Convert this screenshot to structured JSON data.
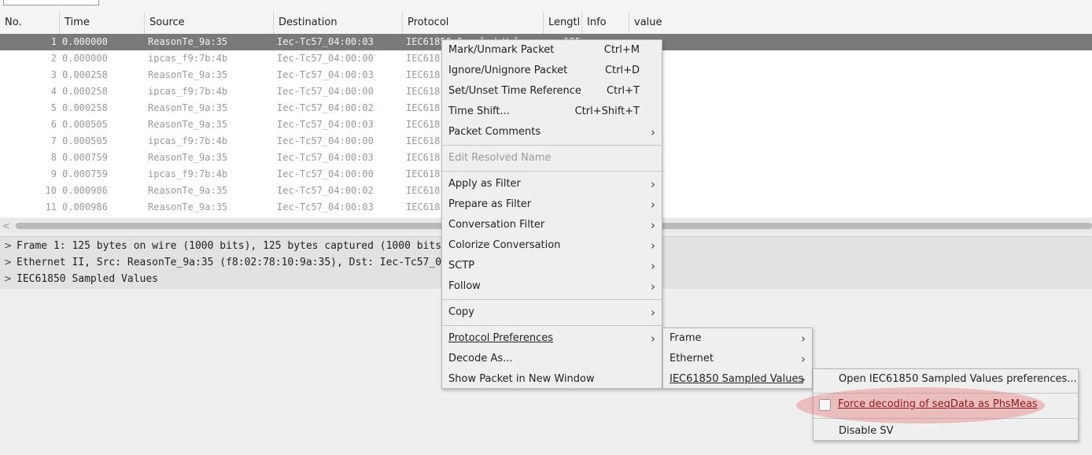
{
  "columns": [
    "No.",
    "Time",
    "Source",
    "Destination",
    "Protocol",
    "Lengtl",
    "Info",
    "value"
  ],
  "packets": [
    {
      "no": "1",
      "time": "0.000000",
      "source": "ReasonTe_9a:35",
      "destination": "Iec-Tc57_04:00:03",
      "protocol": "IEC61850 Sampled Valu",
      "length": "125",
      "selected": true
    },
    {
      "no": "2",
      "time": "0.000000",
      "source": "ipcas_f9:7b:4b",
      "destination": "Iec-Tc57_04:00:00",
      "protocol": "IEC618"
    },
    {
      "no": "3",
      "time": "0.000258",
      "source": "ReasonTe_9a:35",
      "destination": "Iec-Tc57_04:00:03",
      "protocol": "IEC618"
    },
    {
      "no": "4",
      "time": "0.000258",
      "source": "ipcas_f9:7b:4b",
      "destination": "Iec-Tc57_04:00:00",
      "protocol": "IEC618"
    },
    {
      "no": "5",
      "time": "0.000258",
      "source": "ReasonTe_9a:35",
      "destination": "Iec-Tc57_04:00:02",
      "protocol": "IEC618"
    },
    {
      "no": "6",
      "time": "0.000505",
      "source": "ReasonTe_9a:35",
      "destination": "Iec-Tc57_04:00:03",
      "protocol": "IEC618"
    },
    {
      "no": "7",
      "time": "0.000505",
      "source": "ipcas_f9:7b:4b",
      "destination": "Iec-Tc57_04:00:00",
      "protocol": "IEC618"
    },
    {
      "no": "8",
      "time": "0.000759",
      "source": "ReasonTe_9a:35",
      "destination": "Iec-Tc57_04:00:03",
      "protocol": "IEC618"
    },
    {
      "no": "9",
      "time": "0.000759",
      "source": "ipcas_f9:7b:4b",
      "destination": "Iec-Tc57_04:00:00",
      "protocol": "IEC618"
    },
    {
      "no": "10",
      "time": "0.000986",
      "source": "ReasonTe_9a:35",
      "destination": "Iec-Tc57_04:00:02",
      "protocol": "IEC618"
    },
    {
      "no": "11",
      "time": "0.000986",
      "source": "ReasonTe_9a:35",
      "destination": "Iec-Tc57_04:00:03",
      "protocol": "IEC618"
    }
  ],
  "details": [
    "Frame 1: 125 bytes on wire (1000 bits), 125 bytes captured (1000 bits",
    "Ethernet II, Src: ReasonTe_9a:35 (f8:02:78:10:9a:35), Dst: Iec-Tc57_04",
    "IEC61850 Sampled Values"
  ],
  "context_menu": {
    "mark": {
      "label": "Mark/Unmark Packet",
      "shortcut": "Ctrl+M"
    },
    "ignore": {
      "label": "Ignore/Unignore Packet",
      "shortcut": "Ctrl+D"
    },
    "time_ref": {
      "label": "Set/Unset Time Reference",
      "shortcut": "Ctrl+T"
    },
    "time_shift": {
      "label": "Time Shift...",
      "shortcut": "Ctrl+Shift+T"
    },
    "comments": {
      "label": "Packet Comments"
    },
    "edit_resolved": {
      "label": "Edit Resolved Name"
    },
    "apply_filter": {
      "label": "Apply as Filter"
    },
    "prepare_filter": {
      "label": "Prepare as Filter"
    },
    "conversation_filter": {
      "label": "Conversation Filter"
    },
    "colorize": {
      "label": "Colorize Conversation"
    },
    "sctp": {
      "label": "SCTP"
    },
    "follow": {
      "label": "Follow"
    },
    "copy": {
      "label": "Copy"
    },
    "protocol_prefs": {
      "label": "Protocol Preferences"
    },
    "decode_as": {
      "label": "Decode As..."
    },
    "new_window": {
      "label": "Show Packet in New Window"
    }
  },
  "prefs_submenu": {
    "frame": "Frame",
    "ethernet": "Ethernet",
    "sv": "IEC61850 Sampled Values"
  },
  "sv_submenu": {
    "open_prefs": "Open IEC61850 Sampled Values preferences...",
    "force_decoding": "Force decoding of seqData as PhsMeas",
    "force_decoding_checked": false,
    "disable": "Disable SV"
  },
  "submenu_arrow": "›",
  "expand_arrow": ">"
}
